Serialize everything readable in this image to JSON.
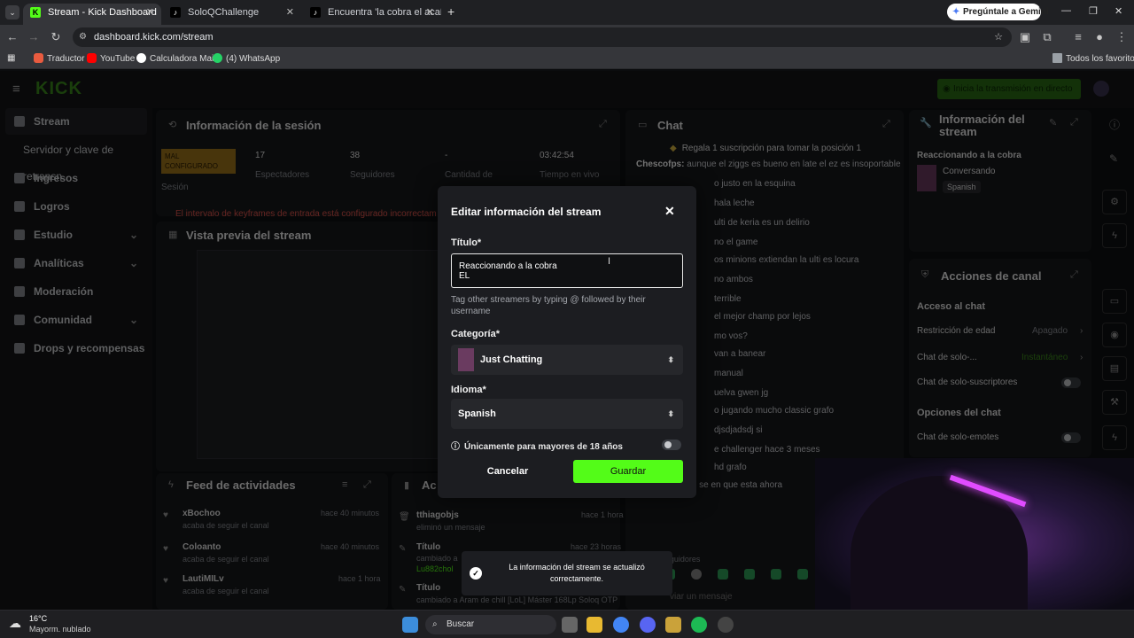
{
  "browser": {
    "tabs": [
      {
        "title": "Stream - Kick Dashboard",
        "active": true
      },
      {
        "title": "SoloQChallenge",
        "active": false
      },
      {
        "title": "Encuentra 'la cobra el acabado",
        "active": false
      }
    ],
    "gemini_button": "Pregúntale a Gemini",
    "url": "dashboard.kick.com/stream",
    "bookmarks": [
      "Traductor",
      "YouTube",
      "Calculadora Main",
      "(4) WhatsApp"
    ],
    "all_bookmarks": "Todos los favoritos"
  },
  "app": {
    "logo": "KICK",
    "live_button": "Inicia la transmisión en directo",
    "accent": "#53fc18"
  },
  "sidebar": {
    "items": [
      {
        "label": "Stream",
        "active": true
      },
      {
        "label": "Servidor y clave de retransn"
      },
      {
        "label": "Ingresos"
      },
      {
        "label": "Logros"
      },
      {
        "label": "Estudio",
        "expandable": true
      },
      {
        "label": "Analíticas",
        "expandable": true
      },
      {
        "label": "Moderación"
      },
      {
        "label": "Comunidad",
        "expandable": true
      },
      {
        "label": "Drops y recompensas"
      }
    ]
  },
  "session": {
    "title": "Información de la sesión",
    "badge": "MAL CONFIGURADO",
    "badge_label": "Sesión",
    "stats": [
      {
        "value": "17",
        "label": "Espectadores"
      },
      {
        "value": "38",
        "label": "Seguidores"
      },
      {
        "value": "-",
        "label": "Cantidad de"
      },
      {
        "value": "03:42:54",
        "label": "Tiempo en vivo"
      }
    ],
    "warning": "El intervalo de keyframes de entrada está configurado incorrectam"
  },
  "preview": {
    "title": "Vista previa del stream"
  },
  "feed": {
    "title": "Feed de actividades",
    "items": [
      {
        "name": "xBochoo",
        "action": "acaba de seguir el canal",
        "time": "hace 40 minutos"
      },
      {
        "name": "Coloanto",
        "action": "acaba de seguir el canal",
        "time": "hace 40 minutos"
      },
      {
        "name": "LautiMILv",
        "action": "acaba de seguir el canal",
        "time": "hace 1 hora"
      }
    ]
  },
  "actions_log": {
    "title": "Ac",
    "items": [
      {
        "name": "tthiagobjs",
        "action": "eliminó un mensaje",
        "time": "hace 1 hora"
      },
      {
        "name": "Título",
        "action": "cambiado a",
        "sub": "Lu882chol",
        "time": "hace 23 horas"
      },
      {
        "name": "Título",
        "action": "cambiado a Aram de chill [LoL] Máster 168Lp Soloq OTP",
        "time": ""
      }
    ]
  },
  "chat": {
    "title": "Chat",
    "pinned": "Regala 1 suscripción para tomar la posición 1",
    "messages": [
      {
        "user": "Chescofps:",
        "text": "aunque el ziggs es bueno en late el ez es insoportable"
      },
      {
        "user": "",
        "text": "o justo en la esquina"
      },
      {
        "user": "",
        "text": "hala leche"
      },
      {
        "user": "",
        "text": "ulti de keria es un delirio"
      },
      {
        "user": "",
        "text": "no el game"
      },
      {
        "user": "",
        "text": "os minions extiendan la ulti es locura"
      },
      {
        "user": "",
        "text": "no ambos"
      },
      {
        "user": "",
        "text": "terrible"
      },
      {
        "user": "",
        "text": "el mejor champ por lejos"
      },
      {
        "user": "",
        "text": "mo vos?"
      },
      {
        "user": "",
        "text": "van a banear"
      },
      {
        "user": "",
        "text": "manual"
      },
      {
        "user": "",
        "text": "uelva gwen jg"
      },
      {
        "user": "",
        "text": "o jugando mucho classic grafo"
      },
      {
        "user": "",
        "text": "djsdjadsdj si"
      },
      {
        "user": "",
        "text": "e challenger hace 3 meses"
      },
      {
        "user": "",
        "text": "hd grafo"
      },
      {
        "user": "Chescofps:",
        "text": "no se en que esta ahora"
      }
    ],
    "followers_only": "Solo seguidores",
    "input_placeholder": "viar un mensaje"
  },
  "stream_info": {
    "title": "Información del stream",
    "stream_title": "Reaccionando a la cobra",
    "category": "Conversando",
    "language": "Spanish"
  },
  "channel_actions": {
    "title": "Acciones de canal",
    "chat_access": "Acceso al chat",
    "rows": [
      {
        "label": "Restricción de edad",
        "value": "Apagado"
      },
      {
        "label": "Chat de solo-...",
        "value": "Instantáneo"
      },
      {
        "label": "Chat de solo-suscriptores",
        "value": ""
      }
    ],
    "chat_options": "Opciones del chat",
    "emotes_only": "Chat de solo-emotes"
  },
  "modal": {
    "title": "Editar información del stream",
    "title_label": "Título*",
    "title_value_line1": "Reaccionando a la cobra",
    "title_value_line2": "EL",
    "helper": "Tag other streamers by typing @ followed by their username",
    "category_label": "Categoría*",
    "category_value": "Just Chatting",
    "language_label": "Idioma*",
    "language_value": "Spanish",
    "adult_label": "Únicamente para mayores de 18 años",
    "cancel": "Cancelar",
    "save": "Guardar"
  },
  "toast": {
    "message": "La información del stream se actualizó correctamente."
  },
  "taskbar": {
    "weather_temp": "16°C",
    "weather_desc": "Mayorm. nublado",
    "search": "Buscar"
  }
}
